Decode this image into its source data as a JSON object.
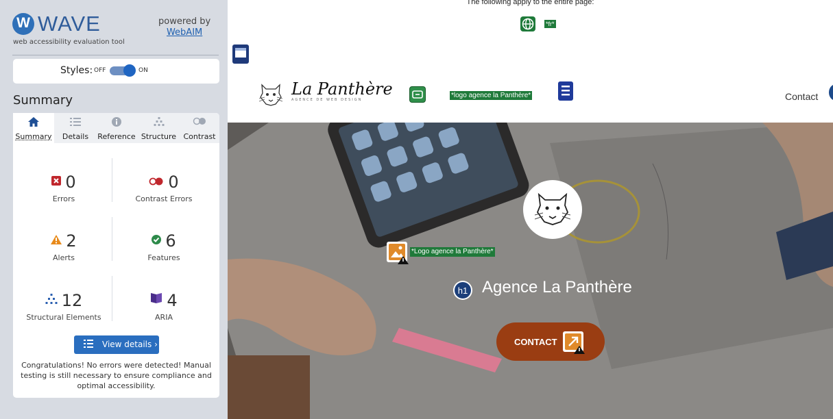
{
  "wave": {
    "logo_word": "WAVE",
    "tagline": "web accessibility evaluation tool",
    "powered_by": "powered by",
    "webaim": "WebAIM",
    "styles_label": "Styles:",
    "styles_off": "OFF",
    "styles_on": "ON",
    "styles_enabled": true,
    "summary_heading": "Summary",
    "tabs": [
      {
        "label": "Summary",
        "icon": "home-icon",
        "active": true
      },
      {
        "label": "Details",
        "icon": "list-icon",
        "active": false
      },
      {
        "label": "Reference",
        "icon": "info-icon",
        "active": false
      },
      {
        "label": "Structure",
        "icon": "structure-icon",
        "active": false
      },
      {
        "label": "Contrast",
        "icon": "contrast-icon",
        "active": false
      }
    ],
    "stats": {
      "errors": {
        "value": "0",
        "label": "Errors",
        "icon": "error-icon",
        "color": "#c0272d"
      },
      "contrast_errors": {
        "value": "0",
        "label": "Contrast Errors",
        "icon": "contrast-error-icon",
        "color": "#c0272d"
      },
      "alerts": {
        "value": "2",
        "label": "Alerts",
        "icon": "alert-icon",
        "color": "#e88a1a"
      },
      "features": {
        "value": "6",
        "label": "Features",
        "icon": "feature-icon",
        "color": "#2d8a4a"
      },
      "structural": {
        "value": "12",
        "label": "Structural Elements",
        "icon": "structure-icon",
        "color": "#2a5fb0"
      },
      "aria": {
        "value": "4",
        "label": "ARIA",
        "icon": "aria-icon",
        "color": "#4a2d8a"
      }
    },
    "view_details": "View details ›",
    "congrats": "Congratulations! No errors were detected! Manual testing is still necessary to ensure compliance and optimal accessibility."
  },
  "preview": {
    "page_info_text": "The following apply to the entire page:",
    "lang_badge": "*fr*",
    "site_name": "La Panthère",
    "site_sub": "AGENCE DE WEB DESIGN",
    "header_alt_badge": "*logo agence la Panthère*",
    "nav_contact": "Contact",
    "hero_alt_badge": "*Logo agence la Panthère*",
    "hero_title": "Agence La Panthère",
    "contact_button": "CONTACT"
  }
}
